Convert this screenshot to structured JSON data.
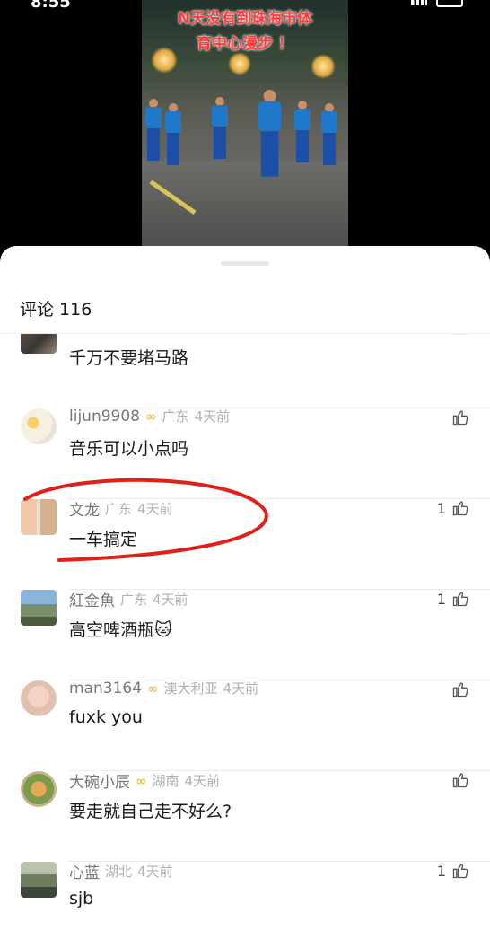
{
  "status_bar": {
    "time": "8:55"
  },
  "video": {
    "caption_line1": "N天没有到珠海市体",
    "caption_line2": "育中心漫步 ！"
  },
  "comments_panel": {
    "title": "评论 116",
    "comments": [
      {
        "username": "…",
        "location": "",
        "time": "",
        "text": "千万不要堵马路",
        "likes": "",
        "badge": false
      },
      {
        "username": "lijun9908",
        "location": "广东",
        "time": "4天前",
        "text": "音乐可以小点吗",
        "likes": "",
        "badge": true
      },
      {
        "username": "文龙",
        "location": "广东",
        "time": "4天前",
        "text": "一车搞定",
        "likes": "1",
        "badge": false
      },
      {
        "username": "紅金魚",
        "location": "广东",
        "time": "4天前",
        "text": "高空啤酒瓶🐱",
        "likes": "1",
        "badge": false
      },
      {
        "username": "man3164",
        "location": "澳大利亚",
        "time": "4天前",
        "text": "fuxk you",
        "likes": "",
        "badge": true
      },
      {
        "username": "大碗小辰",
        "location": "湖南",
        "time": "4天前",
        "text": "要走就自己走不好么?",
        "likes": "",
        "badge": true
      },
      {
        "username": "心蓝",
        "location": "湖北",
        "time": "4天前",
        "text": "sjb",
        "likes": "1",
        "badge": false
      }
    ]
  },
  "icons": {
    "like": "thumbs-up-icon",
    "badge": "infinity-badge-icon"
  },
  "colors": {
    "annotation": "#e0201a",
    "badge": "#e6b02e",
    "caption": "#ff3b3b"
  }
}
